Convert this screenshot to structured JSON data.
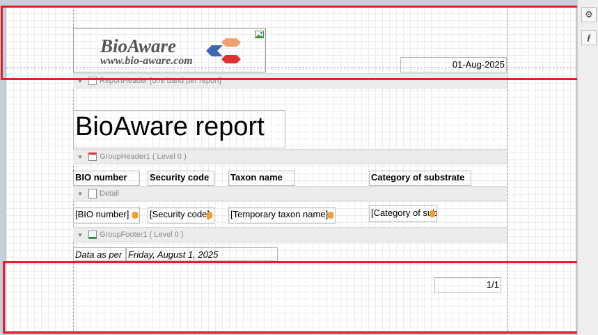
{
  "page_header": {
    "logo_text": "BioAware",
    "logo_url": "www.bio-aware.com",
    "date": "01-Aug-2025"
  },
  "report_header": {
    "band_label": "ReportHeader [one band per report]",
    "title": "BioAware report"
  },
  "group_header": {
    "band_label": "GroupHeader1 ( Level 0 )",
    "columns": [
      "BIO number",
      "Security code",
      "Taxon name",
      "Category of substrate"
    ]
  },
  "detail": {
    "band_label": "Detail",
    "fields": [
      "[BIO number]",
      "[Security code]",
      "[Temporary taxon name]",
      "[Category of substrate]"
    ]
  },
  "group_footer": {
    "band_label": "GroupFooter1 ( Level 0 )",
    "label": "Data as per",
    "date": "Friday, August 1, 2025"
  },
  "page_footer": {
    "page_number": "1/1"
  },
  "side_panel": {
    "settings_icon": "gear-icon",
    "function_icon": "function-icon",
    "function_glyph": "ƒ"
  },
  "colors": {
    "highlight": "#e0202a",
    "logo_text": "#555555"
  }
}
